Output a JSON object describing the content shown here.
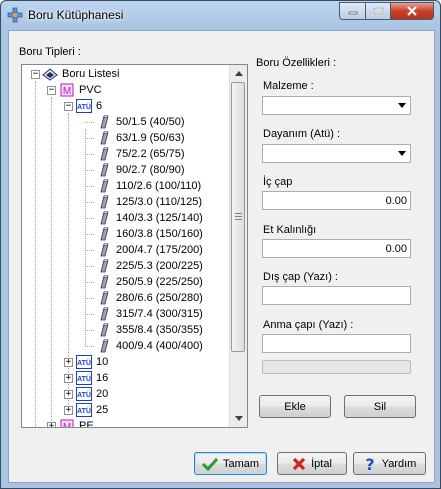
{
  "window": {
    "title": "Boru Kütüphanesi"
  },
  "tree_panel": {
    "label": "Boru Tipleri :"
  },
  "tree": {
    "root": "Boru Listesi",
    "material": "PVC",
    "group_open": "6",
    "pipes": [
      "50/1.5 (40/50)",
      "63/1.9 (50/63)",
      "75/2.2 (65/75)",
      "90/2.7 (80/90)",
      "110/2.6 (100/110)",
      "125/3.0 (110/125)",
      "140/3.3 (125/140)",
      "160/3.8 (150/160)",
      "200/4.7 (175/200)",
      "225/5.3 (200/225)",
      "250/5.9 (225/250)",
      "280/6.6 (250/280)",
      "315/7.4 (300/315)",
      "355/8.4 (350/355)",
      "400/9.4 (400/400)"
    ],
    "groups_closed": [
      "10",
      "16",
      "20",
      "25"
    ],
    "material2": "PE",
    "atu_badge": "ATÜ",
    "pvc_badge": "M"
  },
  "properties": {
    "label": "Boru Özellikleri :",
    "malzeme_label": "Malzeme :",
    "malzeme_value": "",
    "dayanim_label": "Dayanım (Atü) :",
    "dayanim_value": "",
    "ic_cap_label": "İç çap",
    "ic_cap_value": "0.00",
    "et_label": "Et Kalınlığı",
    "et_value": "0.00",
    "dis_cap_label": "Dış çap (Yazı) :",
    "dis_cap_value": "",
    "anma_label": "Anma çapı (Yazı) :",
    "anma_value": ""
  },
  "buttons": {
    "ekle": "Ekle",
    "sil": "Sil",
    "tamam": "Tamam",
    "iptal": "İptal",
    "yardim": "Yardım"
  },
  "colors": {
    "titlebar": "#bcd4ee",
    "close": "#c7412b",
    "atu_blue": "#1c3ec8",
    "pvc_magenta": "#c010c0",
    "check_green": "#2a9a2a",
    "x_red": "#d02020",
    "help_blue": "#2050c0"
  }
}
